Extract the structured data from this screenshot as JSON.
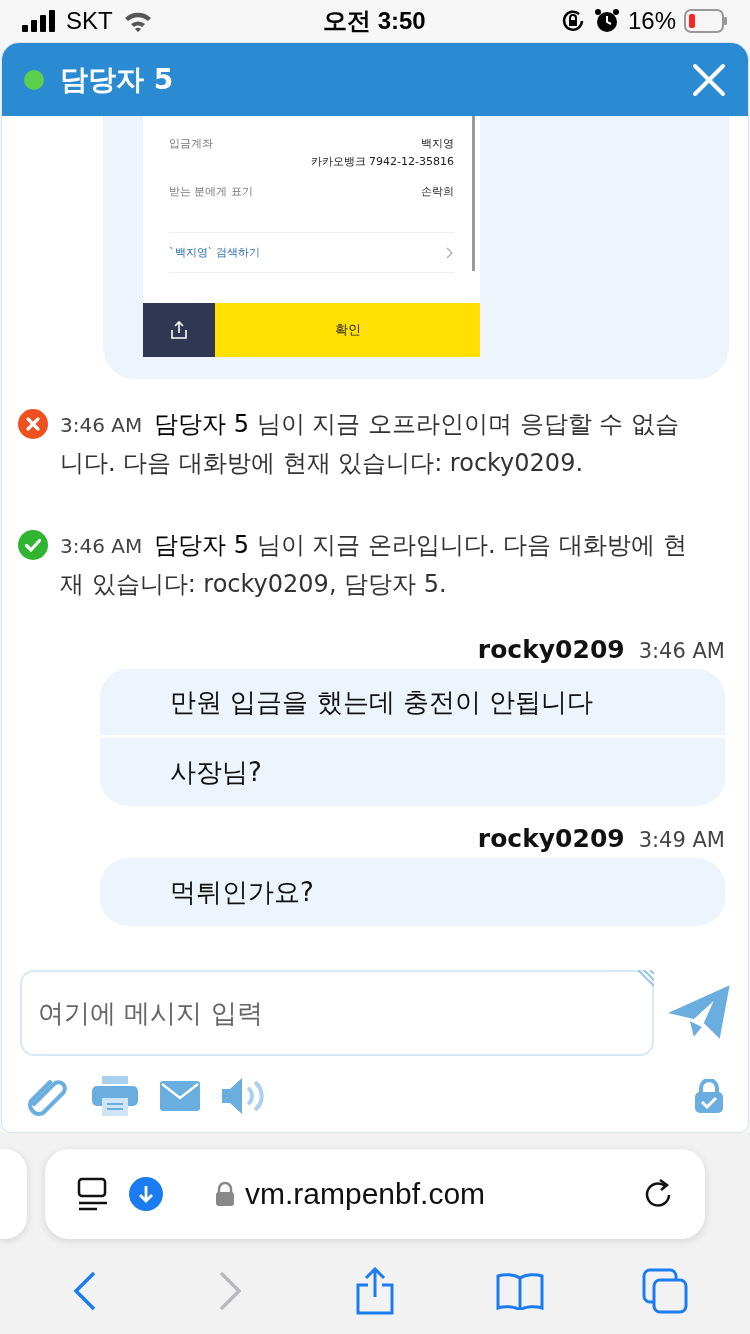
{
  "status_bar": {
    "carrier": "SKT",
    "time": "오전 3:50",
    "battery": "16%"
  },
  "chat": {
    "title": "담당자 5",
    "online": true
  },
  "shared_image": {
    "rows": [
      {
        "label": "입금계좌",
        "value": "백지영",
        "value_2": "카카오뱅크 7942-12-35816"
      },
      {
        "label": "받는 분에게 표기",
        "value": "손락희"
      }
    ],
    "search_link": "`백지영` 검색하기",
    "confirm_button": "확인"
  },
  "events": [
    {
      "kind": "offline",
      "time": "3:46 AM",
      "text": "**담당자 5** 님이 지금 오프라인이며 응답할 수 없습니다. 다음 대화방에 현재 있습니다: rocky0209."
    },
    {
      "kind": "online",
      "time": "3:46 AM",
      "text": "**담당자 5** 님이 지금 온라입니다. 다음 대화방에 현재 있습니다: rocky0209, 담당자 5."
    }
  ],
  "messages": [
    {
      "sender": "rocky0209",
      "time": "3:46 AM",
      "lines": [
        "만원 입금을 했는데 충전이 안됩니다",
        "사장님?"
      ]
    },
    {
      "sender": "rocky0209",
      "time": "3:49 AM",
      "lines": [
        "먹튀인가요?"
      ]
    }
  ],
  "composer": {
    "placeholder": "여기에 메시지 입력"
  },
  "browser": {
    "url": "vm.rampenbf.com",
    "back_disabled": false,
    "forward_disabled": true
  }
}
